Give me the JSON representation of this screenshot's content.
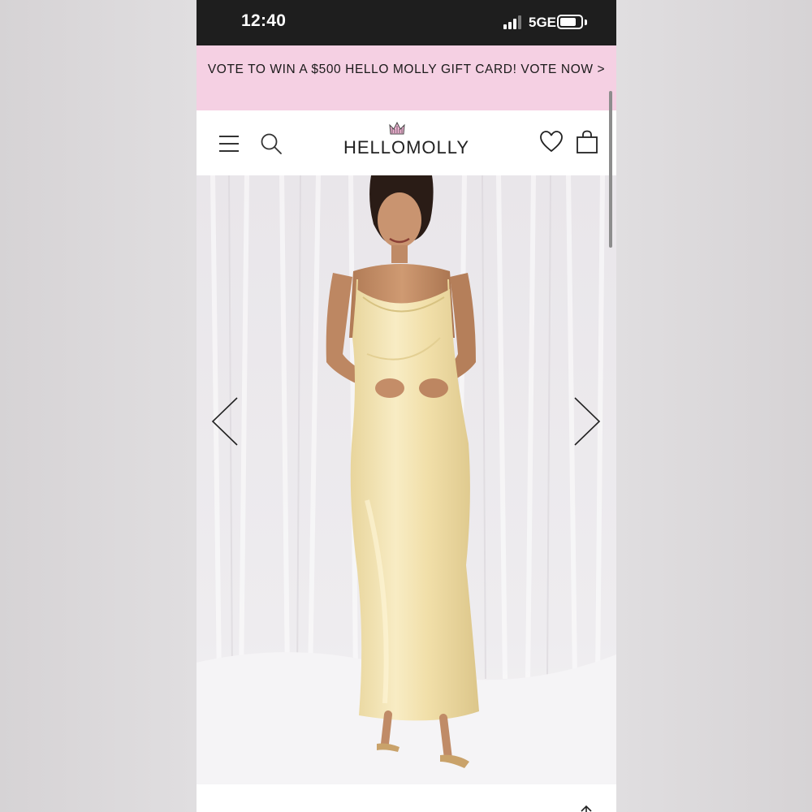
{
  "status_bar": {
    "time": "12:40",
    "network": "5GE",
    "battery_level": 0.8
  },
  "promo": {
    "text": "VOTE TO WIN A $500 HELLO MOLLY GIFT CARD! VOTE NOW >"
  },
  "header": {
    "logo_text": "HELLOMOLLY",
    "icons": [
      "menu-icon",
      "search-icon",
      "crown-icon",
      "heart-icon",
      "bag-icon"
    ]
  },
  "gallery": {
    "product_image": "model-in-champagne-satin-cowl-neck-maxi-dress",
    "icons": [
      "chevron-left-icon",
      "chevron-right-icon"
    ]
  },
  "colors": {
    "promo_bg": "#f5d0e3",
    "status_bg": "#1e1e1e",
    "dress": "#f3e3b0"
  }
}
